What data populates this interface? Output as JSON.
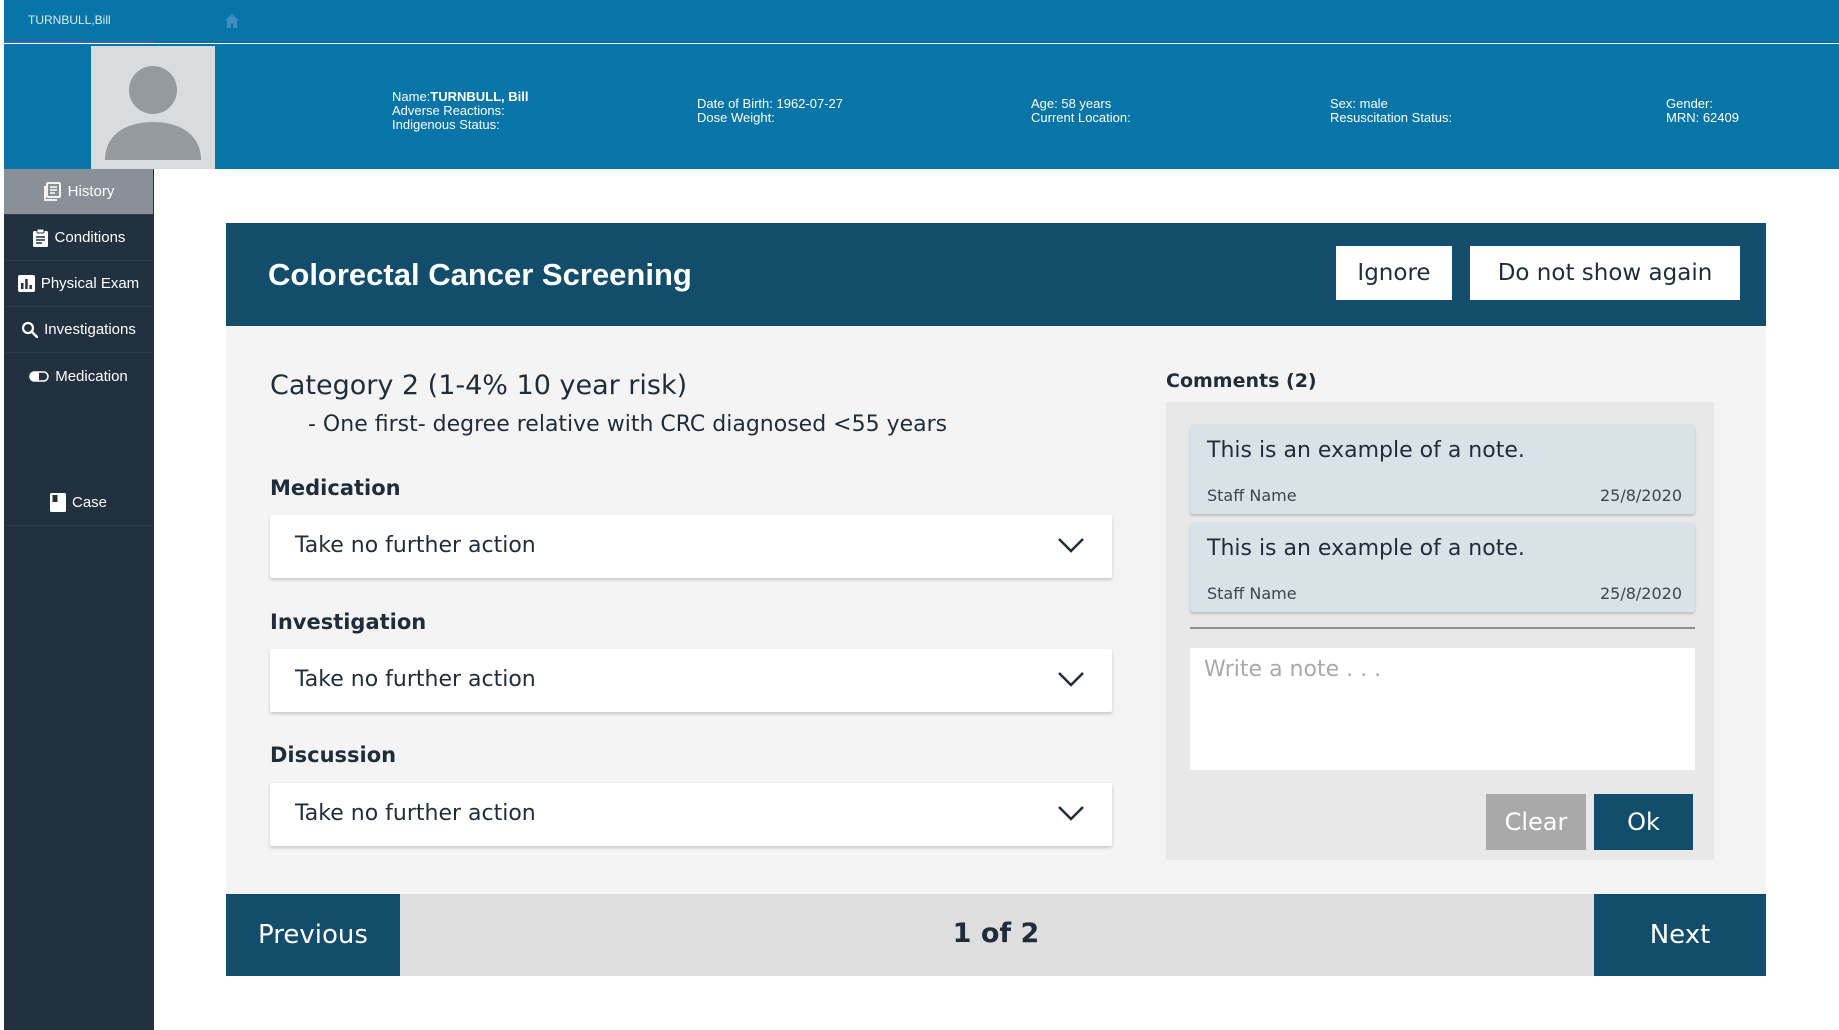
{
  "topbar": {
    "patient_short": "TURNBULL,Bill",
    "home_icon": "home-icon"
  },
  "patient": {
    "name_label": "Name:",
    "name_value": "TURNBULL, Bill",
    "adverse": "Adverse Reactions:",
    "indigenous": "Indigenous Status:",
    "dob": "Date of Birth: 1962-07-27",
    "dose_weight": "Dose Weight:",
    "age": "Age: 58 years",
    "location": "Current Location:",
    "sex": "Sex: male",
    "resus": "Resuscitation Status:",
    "gender": "Gender:",
    "mrn": "MRN: 62409"
  },
  "sidebar": {
    "items": [
      {
        "label": "History",
        "icon": "history-icon",
        "active": true
      },
      {
        "label": "Conditions",
        "icon": "clipboard-icon"
      },
      {
        "label": "Physical Exam",
        "icon": "bar-chart-icon"
      },
      {
        "label": "Investigations",
        "icon": "search-icon"
      },
      {
        "label": "Medication",
        "icon": "pill-icon"
      },
      {
        "label": "Case",
        "icon": "book-icon"
      }
    ]
  },
  "card": {
    "title": "Colorectal Cancer Screening",
    "ignore_label": "Ignore",
    "dont_show_label": "Do not show again",
    "category_title": "Category 2 (1-4% 10 year risk)",
    "category_detail": "- One first- degree relative with CRC diagnosed <55 years",
    "fields": [
      {
        "label": "Medication",
        "value": "Take no further action"
      },
      {
        "label": "Investigation",
        "value": "Take no further action"
      },
      {
        "label": "Discussion",
        "value": "Take no further action"
      }
    ]
  },
  "comments": {
    "label": "Comments (2)",
    "notes": [
      {
        "text": "This is an example of a note.",
        "staff": "Staff Name",
        "date": "25/8/2020"
      },
      {
        "text": "This is an example of a note.",
        "staff": "Staff Name",
        "date": "25/8/2020"
      }
    ],
    "input_placeholder": "Write a note . . .",
    "clear_label": "Clear",
    "ok_label": "Ok"
  },
  "pager": {
    "previous_label": "Previous",
    "count": "1 of 2",
    "next_label": "Next"
  },
  "colors": {
    "header": "#0875a8",
    "sidebar": "#213140",
    "accent": "#124e6b",
    "panel": "#f4f4f4"
  }
}
